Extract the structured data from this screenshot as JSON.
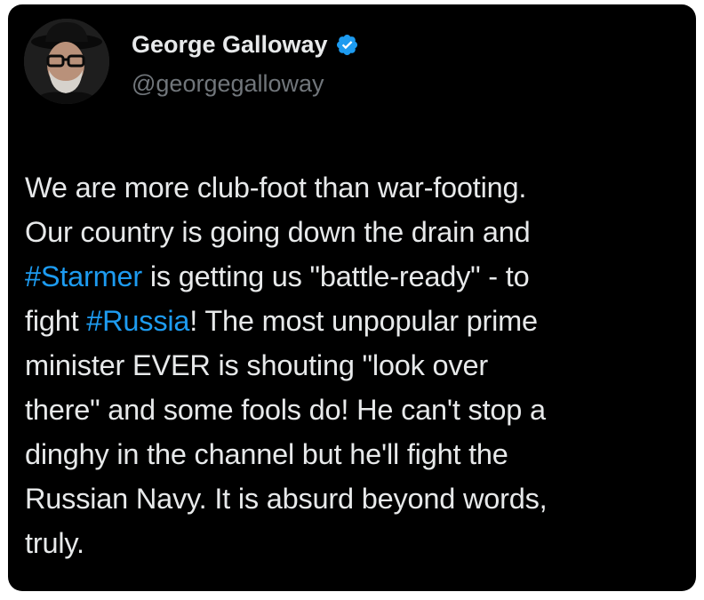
{
  "author": {
    "display_name": "George Galloway",
    "handle": "@georgegalloway",
    "verified": true,
    "verified_color": "#1d9bf0"
  },
  "tweet": {
    "lines": [
      [
        "We are more club-foot than war-footing."
      ],
      [
        "Our country is going down the drain and"
      ],
      [
        "",
        " is getting us \"battle-ready\" - to"
      ],
      [
        "fight ",
        "! The most unpopular prime"
      ],
      [
        "minister EVER is shouting \"look over"
      ],
      [
        "there\" and some fools do! He can't stop a"
      ],
      [
        "dinghy in the channel but he'll fight the"
      ],
      [
        "Russian Navy. It is absurd beyond words,"
      ],
      [
        "truly."
      ]
    ],
    "hashtags": [
      "#Starmer",
      "#Russia"
    ]
  },
  "colors": {
    "background": "#000000",
    "text": "#e7e9ea",
    "secondary_text": "#71767b",
    "link": "#1d9bf0"
  }
}
